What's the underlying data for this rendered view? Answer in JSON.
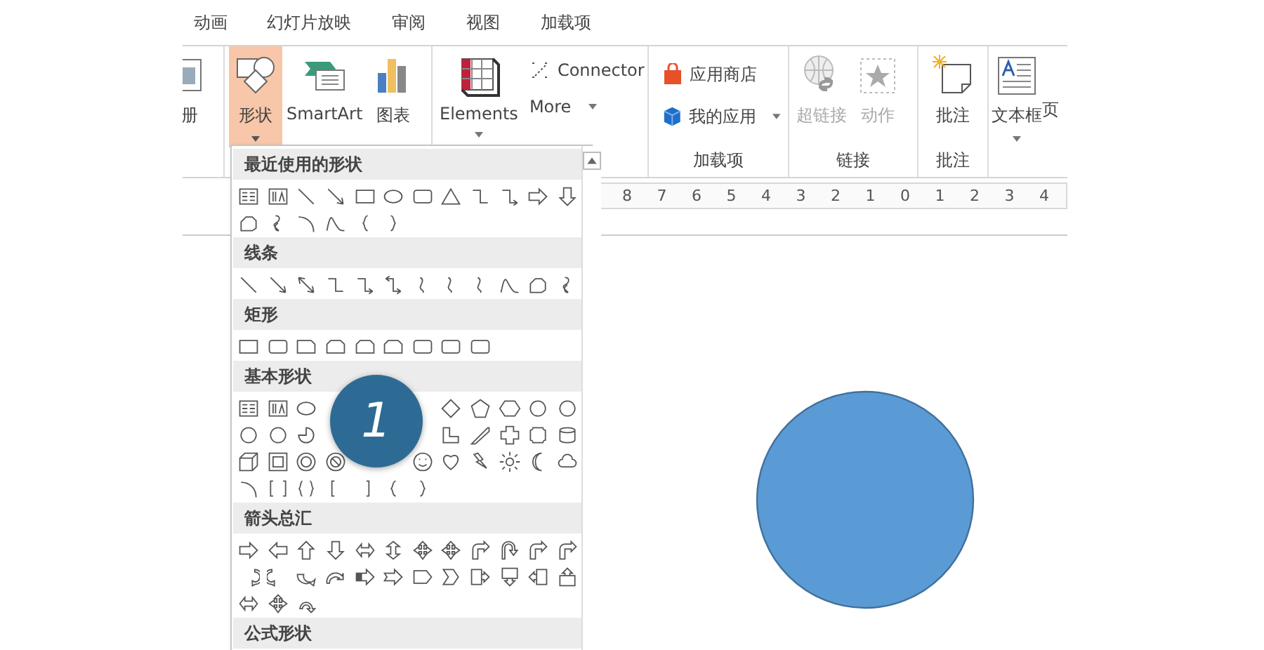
{
  "ribbon_tabs": [
    {
      "label": "动画",
      "selected": false
    },
    {
      "label": "幻灯片放映",
      "selected": false
    },
    {
      "label": "审阅",
      "selected": false
    },
    {
      "label": "视图",
      "selected": false
    },
    {
      "label": "加载项",
      "selected": false
    }
  ],
  "ribbon": {
    "cut_button": "册",
    "illustrations": [
      {
        "kind": "shapes",
        "label": "形状",
        "selected": true
      },
      {
        "kind": "smartart",
        "label": "SmartArt",
        "selected": false
      },
      {
        "kind": "chart",
        "label": "图表",
        "selected": false
      }
    ],
    "elements": {
      "label": "Elements",
      "connector": "Connector",
      "more": "More"
    },
    "addins": {
      "store": "应用商店",
      "my_apps": "我的应用",
      "group": "加载项"
    },
    "links": {
      "items": [
        {
          "kind": "hyperlink",
          "label": "超链接",
          "disabled": true
        },
        {
          "kind": "action",
          "label": "动作",
          "disabled": true
        }
      ],
      "group": "链接"
    },
    "comments": {
      "label": "批注",
      "group": "批注"
    },
    "text": {
      "label": "文本框",
      "cut_label": "页"
    }
  },
  "ruler": [
    "8",
    "7",
    "6",
    "5",
    "4",
    "3",
    "2",
    "1",
    "0",
    "1",
    "2",
    "3",
    "4"
  ],
  "shapes_gallery": {
    "sections": [
      {
        "title": "最近使用的形状"
      },
      {
        "title": "线条"
      },
      {
        "title": "矩形"
      },
      {
        "title": "基本形状"
      },
      {
        "title": "箭头总汇"
      },
      {
        "title": "公式形状"
      }
    ]
  },
  "callout": {
    "number": "1"
  },
  "slide": {
    "shape": {
      "kind": "circle",
      "color": "#5b9bd5"
    }
  }
}
